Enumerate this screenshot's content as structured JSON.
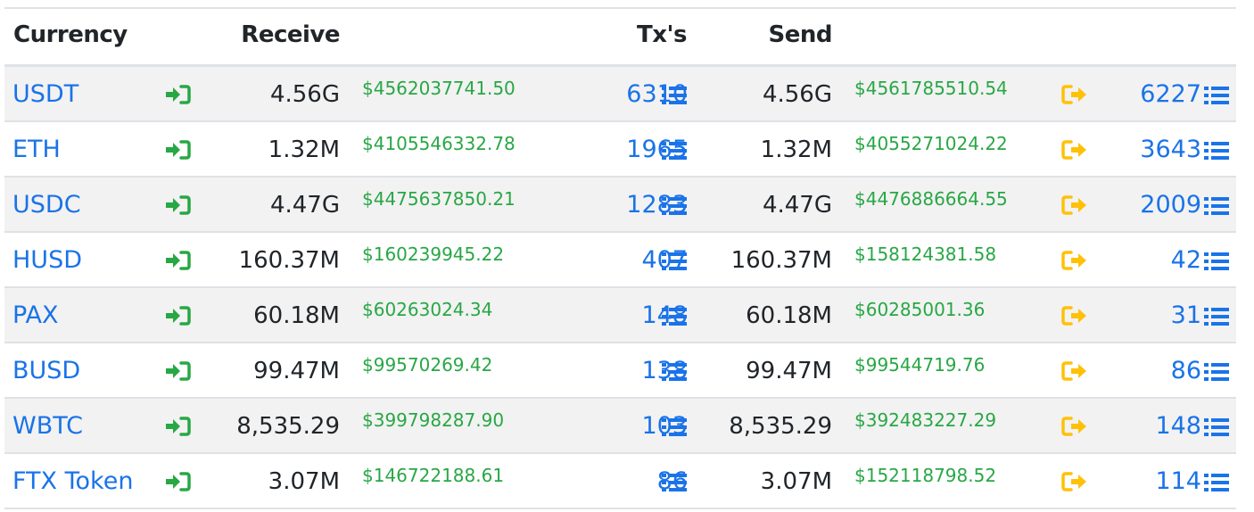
{
  "header": {
    "currency": "Currency",
    "receive": "Receive",
    "txs": "Tx's",
    "send": "Send"
  },
  "colors": {
    "link": "#1a73e8",
    "usd": "#28a745",
    "receive_icon": "#28a745",
    "send_icon": "#ffc107"
  },
  "icons": {
    "receive": "sign-in-icon",
    "send": "sign-out-icon",
    "tx_list": "list-icon"
  },
  "rows": [
    {
      "currency": "USDT",
      "recv_amount": "4.56G",
      "recv_usd": "$4562037741.50",
      "recv_txs": "6310",
      "send_amount": "4.56G",
      "send_usd": "$4561785510.54",
      "send_txs": "6227"
    },
    {
      "currency": "ETH",
      "recv_amount": "1.32M",
      "recv_usd": "$4105546332.78",
      "recv_txs": "1965",
      "send_amount": "1.32M",
      "send_usd": "$4055271024.22",
      "send_txs": "3643"
    },
    {
      "currency": "USDC",
      "recv_amount": "4.47G",
      "recv_usd": "$4475637850.21",
      "recv_txs": "1283",
      "send_amount": "4.47G",
      "send_usd": "$4476886664.55",
      "send_txs": "2009"
    },
    {
      "currency": "HUSD",
      "recv_amount": "160.37M",
      "recv_usd": "$160239945.22",
      "recv_txs": "407",
      "send_amount": "160.37M",
      "send_usd": "$158124381.58",
      "send_txs": "42"
    },
    {
      "currency": "PAX",
      "recv_amount": "60.18M",
      "recv_usd": "$60263024.34",
      "recv_txs": "148",
      "send_amount": "60.18M",
      "send_usd": "$60285001.36",
      "send_txs": "31"
    },
    {
      "currency": "BUSD",
      "recv_amount": "99.47M",
      "recv_usd": "$99570269.42",
      "recv_txs": "138",
      "send_amount": "99.47M",
      "send_usd": "$99544719.76",
      "send_txs": "86"
    },
    {
      "currency": "WBTC",
      "recv_amount": "8,535.29",
      "recv_usd": "$399798287.90",
      "recv_txs": "103",
      "send_amount": "8,535.29",
      "send_usd": "$392483227.29",
      "send_txs": "148"
    },
    {
      "currency": "FTX Token",
      "recv_amount": "3.07M",
      "recv_usd": "$146722188.61",
      "recv_txs": "86",
      "send_amount": "3.07M",
      "send_usd": "$152118798.52",
      "send_txs": "114"
    }
  ]
}
